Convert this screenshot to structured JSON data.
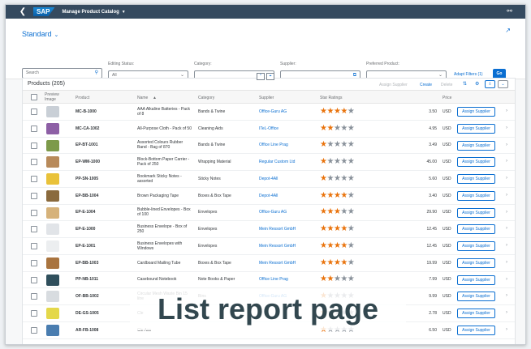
{
  "shell": {
    "back_icon": "chevron-left",
    "logo": "SAP",
    "title": "Manage Product Catalog",
    "user_icon": "person"
  },
  "variant": {
    "label": "Standard"
  },
  "filters": {
    "search_placeholder": "Search",
    "editing_status": {
      "label": "Editing Status:",
      "value": "All"
    },
    "category": {
      "label": "Category:",
      "value": ""
    },
    "supplier": {
      "label": "Supplier:",
      "value": ""
    },
    "preferred_product": {
      "label": "Preferred Product:",
      "value": ""
    },
    "adapt_filters": "Adapt Filters (1)",
    "go": "Go"
  },
  "table": {
    "title": "Products (205)",
    "actions": {
      "assign_supplier": "Assign Supplier",
      "create": "Create",
      "delete": "Delete"
    },
    "columns": [
      "Preview Image",
      "Product",
      "Name",
      "Category",
      "Supplier",
      "Star Ratings",
      "Price"
    ],
    "row_button": "Assign Supplier",
    "rows": [
      {
        "id": "MC-B-1000",
        "name": "AAA Alkaline Batteries - Pack of 8",
        "category": "Bands & Twine",
        "supplier": "Office-Guru AG",
        "stars": 4,
        "price": "3.50",
        "currency": "USD",
        "thumb": "#c9cfd6"
      },
      {
        "id": "MC-CA-1002",
        "name": "All-Purpose Cloth - Pack of 50",
        "category": "Cleaning Aids",
        "supplier": "ITeL-Office",
        "stars": 2,
        "price": "4.95",
        "currency": "USD",
        "thumb": "#8d5fa5"
      },
      {
        "id": "EP-BT-1001",
        "name": "Assorted Colours Rubber Band - Bag of 870",
        "category": "Bands & Twine",
        "supplier": "Office Line Prag",
        "stars": 1,
        "price": "3.49",
        "currency": "USD",
        "thumb": "#7d9a4a"
      },
      {
        "id": "EP-WM-1000",
        "name": "Block-Bottom Paper Carrier - Pack of 250",
        "category": "Wrapping Material",
        "supplier": "Regular Custom Ltd",
        "stars": 1,
        "price": "45.00",
        "currency": "USD",
        "thumb": "#b88a5a"
      },
      {
        "id": "PP-SN-1005",
        "name": "Bookmark Sticky Notes - assorted",
        "category": "Sticky Notes",
        "supplier": "Depot-4All",
        "stars": 1,
        "price": "5.60",
        "currency": "USD",
        "thumb": "#e9c23a"
      },
      {
        "id": "EP-BB-1004",
        "name": "Brown Packaging Tape",
        "category": "Boxes & Box Tape",
        "supplier": "Depot-4All",
        "stars": 4,
        "price": "3.40",
        "currency": "USD",
        "thumb": "#8a6a3d"
      },
      {
        "id": "EP-E-1004",
        "name": "Bubble-lined Envelopes - Box of 100",
        "category": "Envelopes",
        "supplier": "Office-Guru AG",
        "stars": 3,
        "price": "29.90",
        "currency": "USD",
        "thumb": "#d6b27a"
      },
      {
        "id": "EP-E-1000",
        "name": "Business Envelope - Box of 250",
        "category": "Envelopes",
        "supplier": "Mein Ressort GmbH",
        "stars": 4,
        "price": "12.45",
        "currency": "USD",
        "thumb": "#e1e4e8"
      },
      {
        "id": "EP-E-1001",
        "name": "Business Envelopes with Windows",
        "category": "Envelopes",
        "supplier": "Mein Ressort GmbH",
        "stars": 4,
        "price": "12.45",
        "currency": "USD",
        "thumb": "#eceef0"
      },
      {
        "id": "EP-BB-1003",
        "name": "Cardboard Mailing Tube",
        "category": "Boxes & Box Tape",
        "supplier": "Mein Ressort GmbH",
        "stars": 4,
        "price": "19.99",
        "currency": "USD",
        "thumb": "#a9743f"
      },
      {
        "id": "PP-NB-1011",
        "name": "Casebound Notebook",
        "category": "Note Books & Paper",
        "supplier": "Office Line Prag",
        "stars": 2,
        "price": "7.99",
        "currency": "USD",
        "thumb": "#2f4f5c"
      },
      {
        "id": "OF-BB-1002",
        "name": "Circular Mesh Waste Bin 15 litre",
        "category": "Bins",
        "supplier": "Office-Guru AG",
        "stars": 1,
        "price": "9.99",
        "currency": "USD",
        "thumb": "#d8dce0"
      },
      {
        "id": "DE-GS-1005",
        "name": "Cle",
        "category": "",
        "supplier": "",
        "stars": 1,
        "price": "2.78",
        "currency": "USD",
        "thumb": "#e4d84a"
      },
      {
        "id": "AR-FB-1008",
        "name": "Cle Ass",
        "category": "",
        "supplier": "",
        "stars": 1,
        "price": "6.50",
        "currency": "USD",
        "thumb": "#4a7db0"
      }
    ]
  },
  "caption": "List report page"
}
